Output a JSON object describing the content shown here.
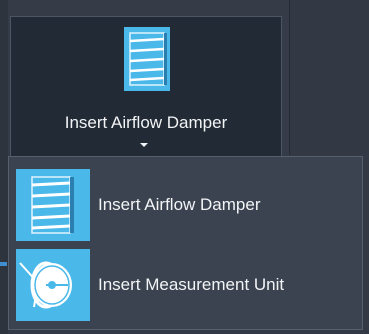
{
  "ribbon_button": {
    "label": "Insert Airflow Damper",
    "icon": "airflow-damper-icon",
    "has_dropdown": true
  },
  "dropdown": {
    "items": [
      {
        "label": "Insert Airflow Damper",
        "icon": "airflow-damper-icon"
      },
      {
        "label": "Insert Measurement Unit",
        "icon": "measurement-unit-icon"
      }
    ]
  },
  "colors": {
    "icon_blue": "#4bb8ea",
    "text": "#f2f4f6",
    "menu_background": "#3b4350",
    "button_background": "#222a35"
  }
}
